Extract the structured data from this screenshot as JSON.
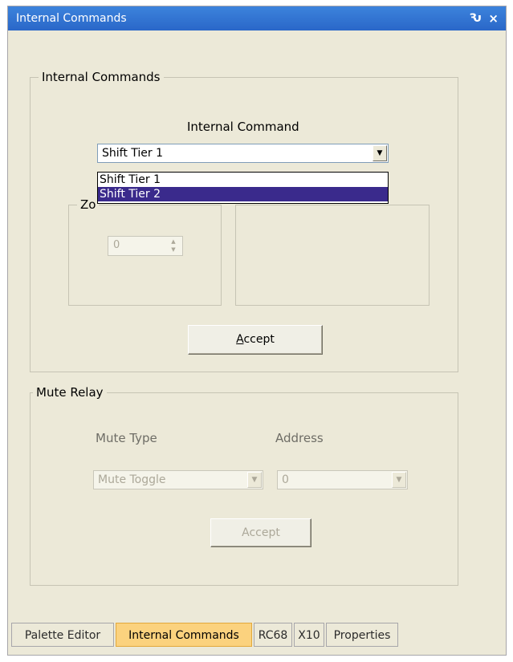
{
  "window": {
    "title": "Internal Commands",
    "pin_glyph": "Ԅ",
    "close_glyph": "×"
  },
  "internal_commands_group": {
    "legend": "Internal Commands",
    "command_label": "Internal Command",
    "command_selected": "Shift Tier 1",
    "dropdown_options": [
      "Shift Tier 1",
      "Shift Tier 2"
    ],
    "zone_legend_partial": "Zo",
    "zone_value": "0",
    "accept_label_rest": "ccept",
    "accept_mnemonic": "A"
  },
  "mute_relay_group": {
    "legend": "Mute Relay",
    "mute_type_label": "Mute Type",
    "address_label": "Address",
    "mute_type_value": "Mute Toggle",
    "address_value": "0",
    "accept_label": "Accept"
  },
  "tabs": [
    {
      "label": "Palette Editor",
      "active": false
    },
    {
      "label": "Internal Commands",
      "active": true
    },
    {
      "label": "RC68",
      "active": false
    },
    {
      "label": "X10",
      "active": false
    },
    {
      "label": "Properties",
      "active": false
    }
  ],
  "icons": {
    "dropdown_arrow": "▼",
    "spin_up": "▲",
    "spin_down": "▼"
  }
}
